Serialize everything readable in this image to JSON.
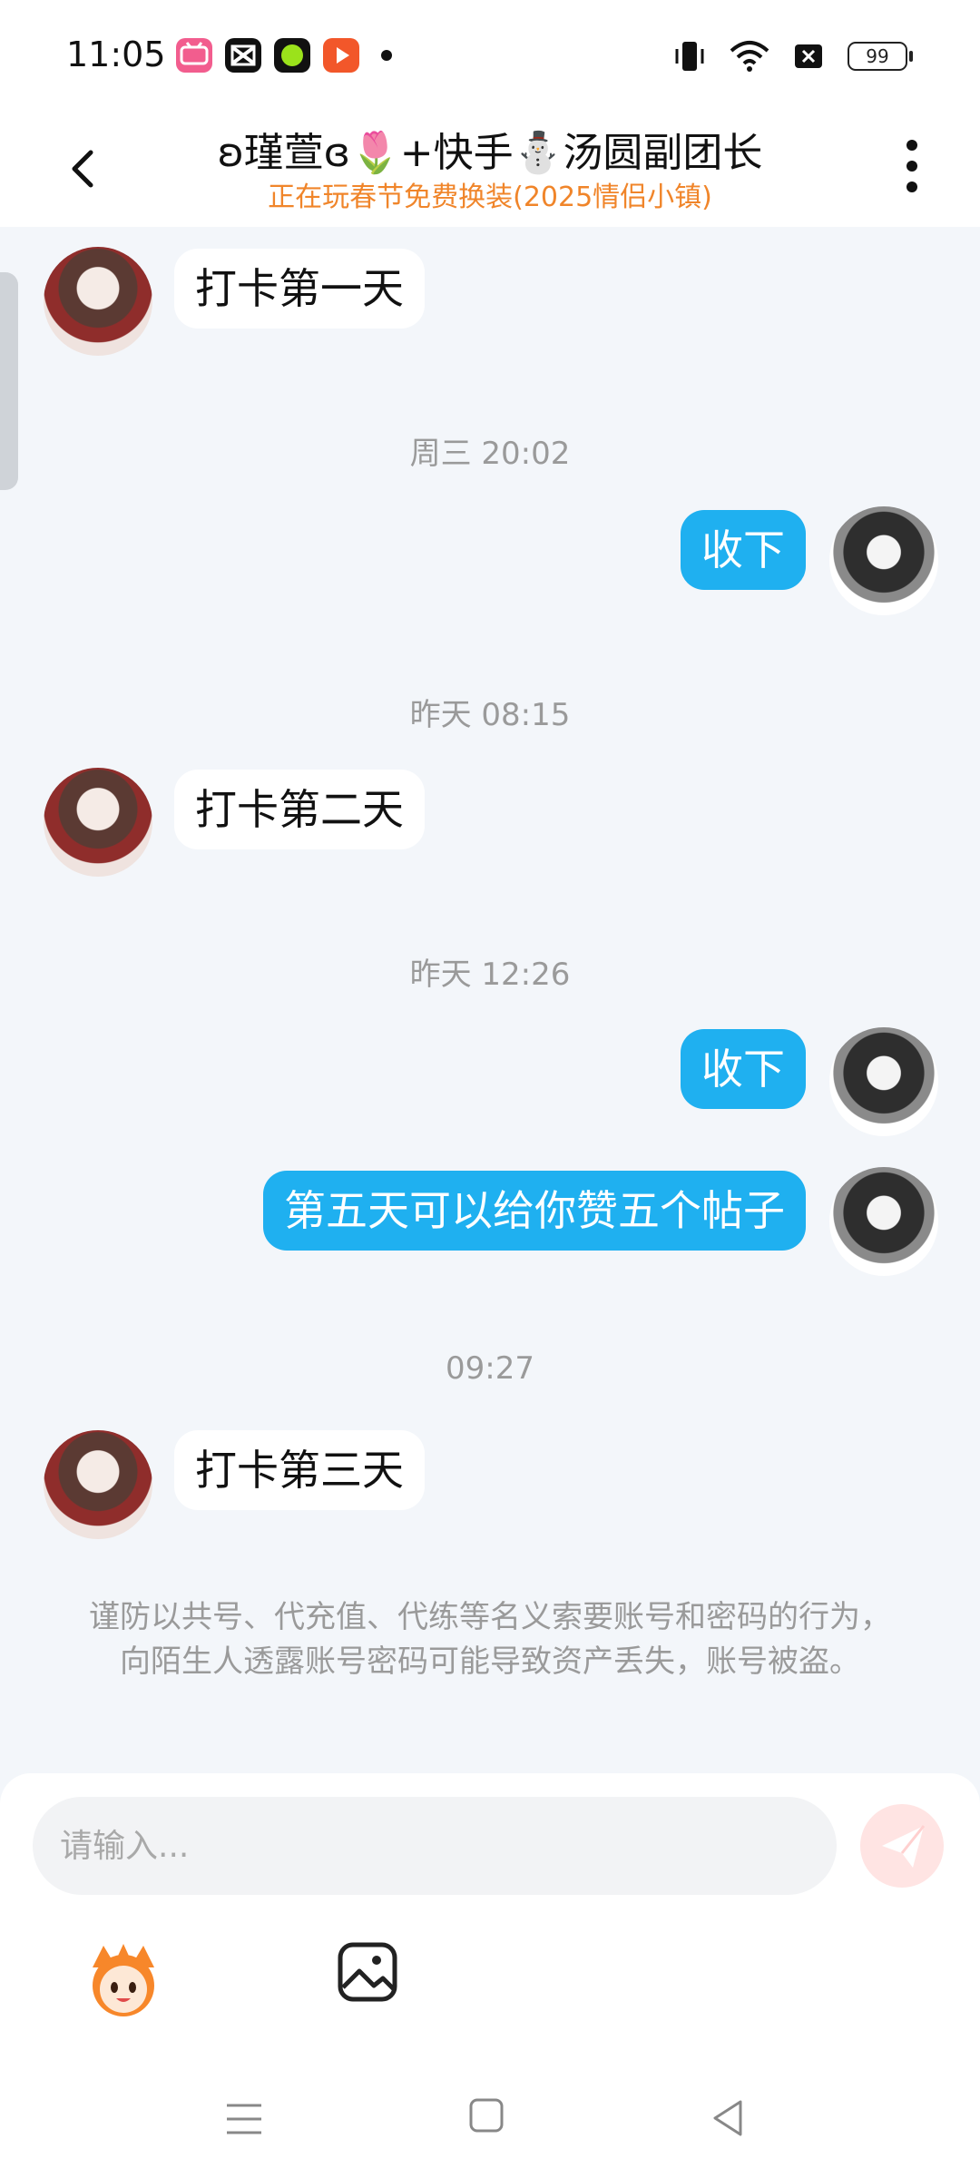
{
  "status_bar": {
    "time": "11:05",
    "battery": "99",
    "app_icons": [
      "bilibili-icon",
      "capcut-icon",
      "green-app-icon",
      "video-player-icon"
    ],
    "indicator_icons": [
      "vibrate-icon",
      "wifi-icon",
      "no-sim-icon",
      "battery-icon"
    ]
  },
  "header": {
    "title": "ʚ瑾萱ɞ🌷+快手⛄汤圆副团长",
    "subtitle": "正在玩春节免费换装(2025情侣小镇)"
  },
  "messages": [
    {
      "side": "left",
      "text": "打卡第一天"
    },
    {
      "type": "time",
      "text": "周三 20:02"
    },
    {
      "side": "right",
      "text": "收下"
    },
    {
      "type": "time",
      "text": "昨天 08:15"
    },
    {
      "side": "left",
      "text": "打卡第二天"
    },
    {
      "type": "time",
      "text": "昨天 12:26"
    },
    {
      "side": "right",
      "text": "收下"
    },
    {
      "side": "right",
      "text": "第五天可以给你赞五个帖子"
    },
    {
      "type": "time",
      "text": "09:27"
    },
    {
      "side": "left",
      "text": "打卡第三天"
    }
  ],
  "warning": "谨防以共号、代充值、代练等名义索要账号和密码的行为，向陌生人透露账号密码可能导致资产丢失，账号被盗。",
  "input": {
    "placeholder": "请输入..."
  },
  "colors": {
    "outgoing_bubble": "#1fb0f0",
    "subtitle": "#f0852a",
    "background": "#f3f6fa"
  }
}
